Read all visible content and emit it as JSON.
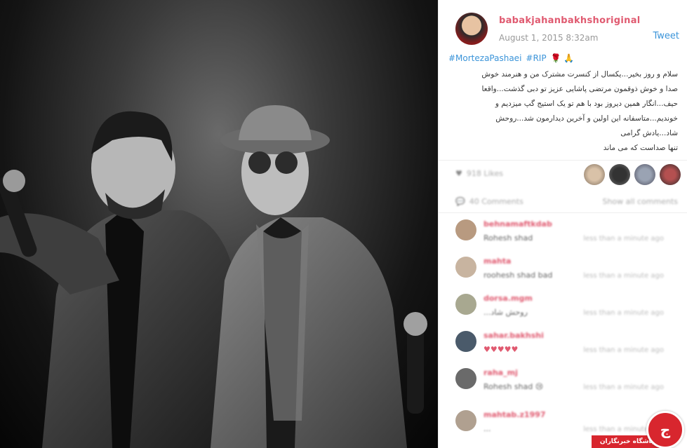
{
  "post": {
    "username": "babakjahanbakhshoriginal",
    "date": "August 1, 2015 8:32am",
    "tweet_label": "Tweet",
    "hashtags": [
      "#MortezaPashaei",
      "#RIP"
    ],
    "emoji": "🌹 🙏",
    "caption_lines": [
      "سلام و روز بخیر...یکسال از کنسرت مشترک من و هنرمند خوش",
      "صدا و خوش ذوقمون مرتضی پاشایی عزیز تو دبی گذشت...واقعا",
      "حیف...انگار همین دیروز بود با هم تو یک استیج گپ میزدیم و",
      "خوندیم...متاسفانه این اولین و آخرین دیدارمون شد...روحش",
      "شاد...یادش گرامی",
      "تنها صداست که می ماند"
    ]
  },
  "stats": {
    "likes_text": "918 Likes",
    "comments_text": "40 Comments",
    "show_all_label": "Show all comments"
  },
  "comments": [
    {
      "user": "behnamaftkdab",
      "text": "Rohesh shad",
      "time": "less than a minute ago",
      "avatar_color": "#b89a80"
    },
    {
      "user": "mahta",
      "text": "roohesh shad bad",
      "time": "less than a minute ago",
      "avatar_color": "#c8b4a0"
    },
    {
      "user": "dorsa.mgm",
      "text": "...روحش شاد",
      "time": "less than a minute ago",
      "avatar_color": "#a8a890"
    },
    {
      "user": "sahar.bakhshi",
      "text": "♥♥♥♥♥",
      "time": "less than a minute ago",
      "avatar_color": "#4a5a6a"
    },
    {
      "user": "raha_mj",
      "text": "Rohesh shad 😢",
      "time": "less than a minute ago",
      "avatar_color": "#6a6a6a"
    },
    {
      "user": "mahtab.z1997",
      "text": "...",
      "time": "less than a minute ago",
      "avatar_color": "#b0a090"
    }
  ],
  "watermark": {
    "label": "باشگاه خبرنگاران",
    "logo_letter": "ج"
  },
  "colors": {
    "username": "#e05a70",
    "link": "#3b94d9",
    "watermark": "#d8262e"
  }
}
